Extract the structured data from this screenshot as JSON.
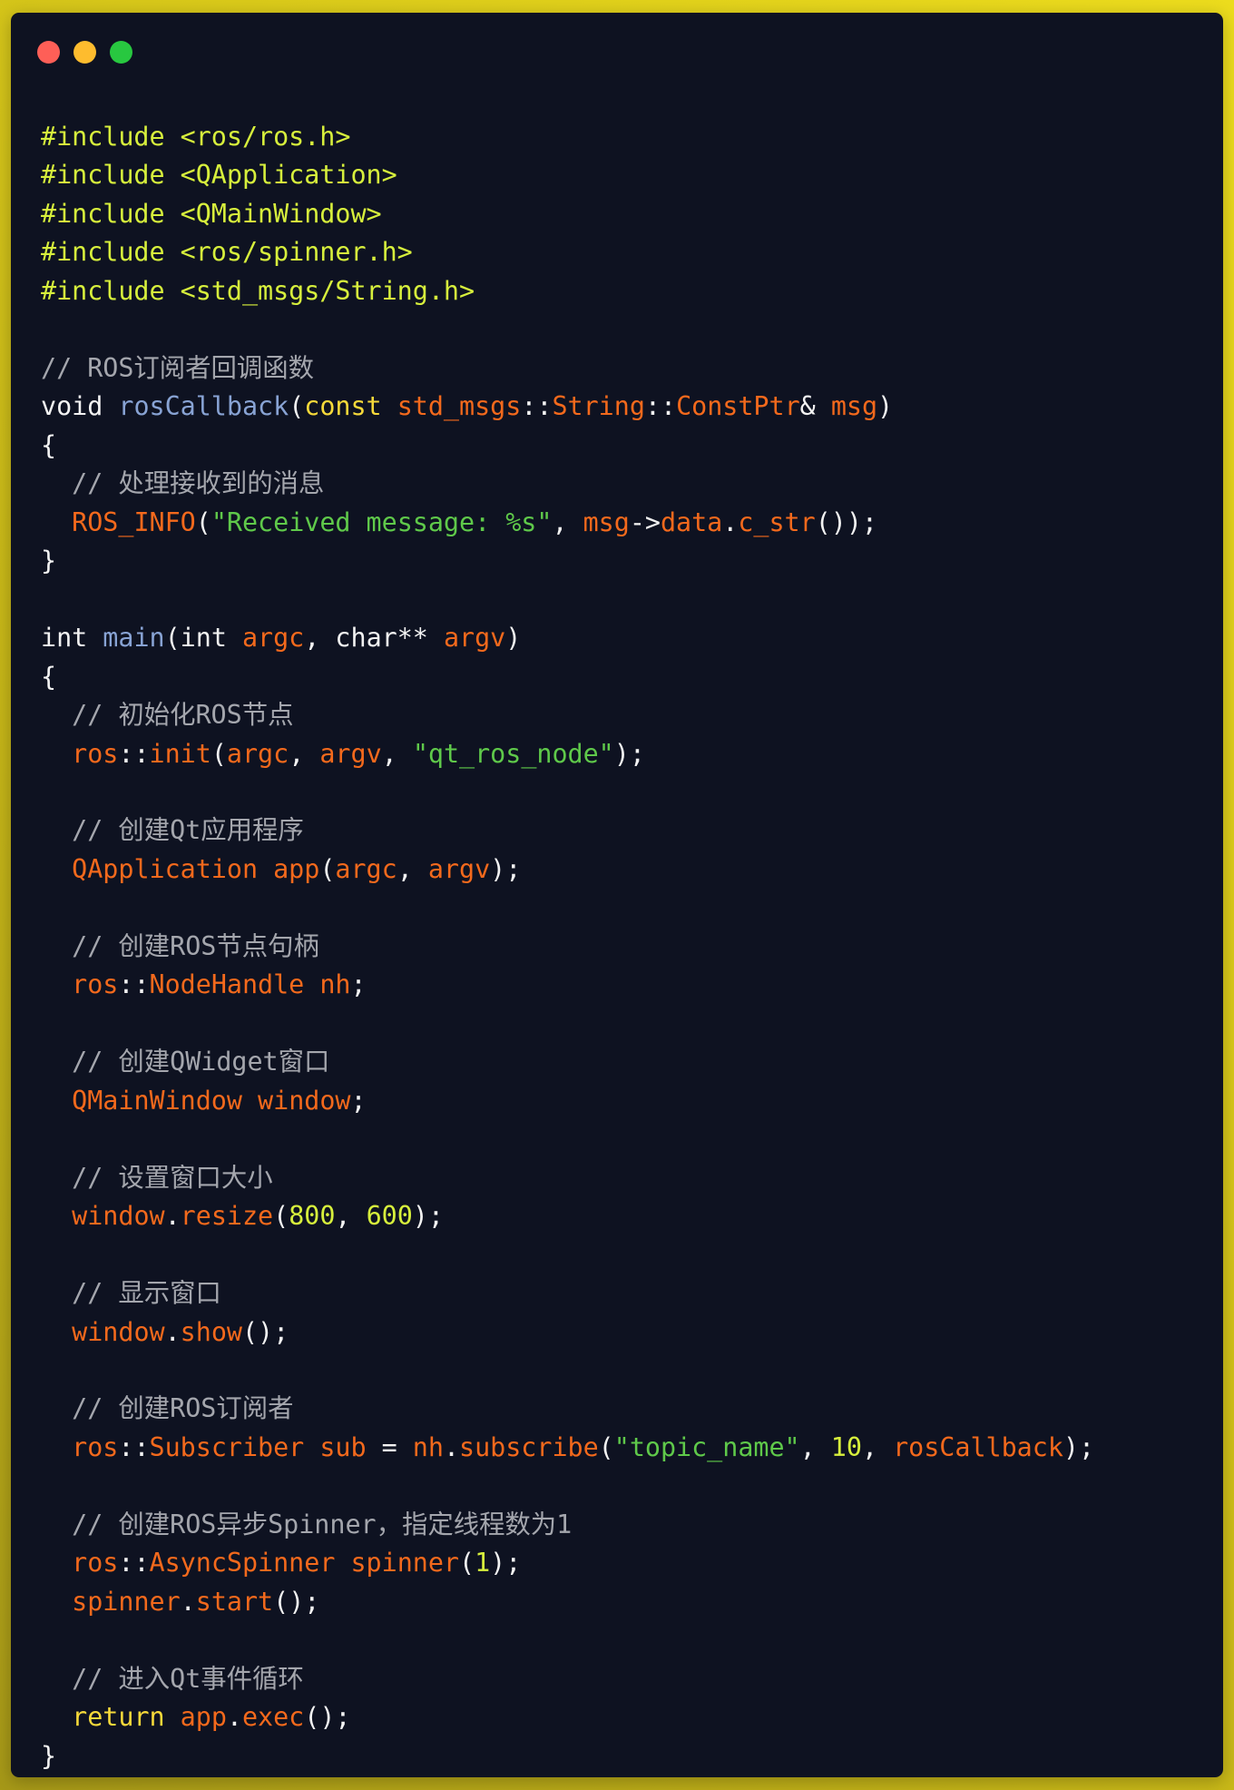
{
  "window": {
    "controls": [
      {
        "name": "close",
        "color": "#fe5f57"
      },
      {
        "name": "minimize",
        "color": "#febc2e"
      },
      {
        "name": "maximize",
        "color": "#28c840"
      }
    ]
  },
  "theme": {
    "background_gradient": [
      "#ecdc1d",
      "#a69818"
    ],
    "editor_background": "#0e1221",
    "token_colors": {
      "pre": "#d7ef3c",
      "kw": "#f6d93a",
      "plain": "#f2f2f2",
      "func": "#88a3d4",
      "var": "#f3691c",
      "str": "#5fc94a",
      "num": "#d7ef3c",
      "comment": "#a4a6ad"
    }
  },
  "code": {
    "language": "cpp",
    "lines": [
      [
        [
          "#include <ros/ros.h>",
          "pre"
        ]
      ],
      [
        [
          "#include <QApplication>",
          "pre"
        ]
      ],
      [
        [
          "#include <QMainWindow>",
          "pre"
        ]
      ],
      [
        [
          "#include <ros/spinner.h>",
          "pre"
        ]
      ],
      [
        [
          "#include <std_msgs/String.h>",
          "pre"
        ]
      ],
      [],
      [
        [
          "// ROS订阅者回调函数",
          "comment"
        ]
      ],
      [
        [
          "void ",
          "plain"
        ],
        [
          "rosCallback",
          "func"
        ],
        [
          "(",
          "plain"
        ],
        [
          "const",
          "kw"
        ],
        [
          " ",
          "plain"
        ],
        [
          "std_msgs",
          "var"
        ],
        [
          "::",
          "plain"
        ],
        [
          "String",
          "var"
        ],
        [
          "::",
          "plain"
        ],
        [
          "ConstPtr",
          "var"
        ],
        [
          "&",
          "plain"
        ],
        [
          " ",
          "plain"
        ],
        [
          "msg",
          "var"
        ],
        [
          ")",
          "plain"
        ]
      ],
      [
        [
          "{",
          "plain"
        ]
      ],
      [
        [
          "  ",
          "plain"
        ],
        [
          "// 处理接收到的消息",
          "comment"
        ]
      ],
      [
        [
          "  ",
          "plain"
        ],
        [
          "ROS_INFO",
          "var"
        ],
        [
          "(",
          "plain"
        ],
        [
          "\"Received message: %s\"",
          "str"
        ],
        [
          ", ",
          "plain"
        ],
        [
          "msg",
          "var"
        ],
        [
          "->",
          "plain"
        ],
        [
          "data",
          "var"
        ],
        [
          ".",
          "plain"
        ],
        [
          "c_str",
          "var"
        ],
        [
          "());",
          "plain"
        ]
      ],
      [
        [
          "}",
          "plain"
        ]
      ],
      [],
      [
        [
          "int ",
          "plain"
        ],
        [
          "main",
          "func"
        ],
        [
          "(",
          "plain"
        ],
        [
          "int ",
          "plain"
        ],
        [
          "argc",
          "var"
        ],
        [
          ", ",
          "plain"
        ],
        [
          "char** ",
          "plain"
        ],
        [
          "argv",
          "var"
        ],
        [
          ")",
          "plain"
        ]
      ],
      [
        [
          "{",
          "plain"
        ]
      ],
      [
        [
          "  ",
          "plain"
        ],
        [
          "// 初始化ROS节点",
          "comment"
        ]
      ],
      [
        [
          "  ",
          "plain"
        ],
        [
          "ros",
          "var"
        ],
        [
          "::",
          "plain"
        ],
        [
          "init",
          "var"
        ],
        [
          "(",
          "plain"
        ],
        [
          "argc",
          "var"
        ],
        [
          ", ",
          "plain"
        ],
        [
          "argv",
          "var"
        ],
        [
          ", ",
          "plain"
        ],
        [
          "\"qt_ros_node\"",
          "str"
        ],
        [
          ");",
          "plain"
        ]
      ],
      [],
      [
        [
          "  ",
          "plain"
        ],
        [
          "// 创建Qt应用程序",
          "comment"
        ]
      ],
      [
        [
          "  ",
          "plain"
        ],
        [
          "QApplication",
          "var"
        ],
        [
          " ",
          "plain"
        ],
        [
          "app",
          "var"
        ],
        [
          "(",
          "plain"
        ],
        [
          "argc",
          "var"
        ],
        [
          ", ",
          "plain"
        ],
        [
          "argv",
          "var"
        ],
        [
          ");",
          "plain"
        ]
      ],
      [],
      [
        [
          "  ",
          "plain"
        ],
        [
          "// 创建ROS节点句柄",
          "comment"
        ]
      ],
      [
        [
          "  ",
          "plain"
        ],
        [
          "ros",
          "var"
        ],
        [
          "::",
          "plain"
        ],
        [
          "NodeHandle",
          "var"
        ],
        [
          " ",
          "plain"
        ],
        [
          "nh",
          "var"
        ],
        [
          ";",
          "plain"
        ]
      ],
      [],
      [
        [
          "  ",
          "plain"
        ],
        [
          "// 创建QWidget窗口",
          "comment"
        ]
      ],
      [
        [
          "  ",
          "plain"
        ],
        [
          "QMainWindow",
          "var"
        ],
        [
          " ",
          "plain"
        ],
        [
          "window",
          "var"
        ],
        [
          ";",
          "plain"
        ]
      ],
      [],
      [
        [
          "  ",
          "plain"
        ],
        [
          "// 设置窗口大小",
          "comment"
        ]
      ],
      [
        [
          "  ",
          "plain"
        ],
        [
          "window",
          "var"
        ],
        [
          ".",
          "plain"
        ],
        [
          "resize",
          "var"
        ],
        [
          "(",
          "plain"
        ],
        [
          "800",
          "num"
        ],
        [
          ", ",
          "plain"
        ],
        [
          "600",
          "num"
        ],
        [
          ");",
          "plain"
        ]
      ],
      [],
      [
        [
          "  ",
          "plain"
        ],
        [
          "// 显示窗口",
          "comment"
        ]
      ],
      [
        [
          "  ",
          "plain"
        ],
        [
          "window",
          "var"
        ],
        [
          ".",
          "plain"
        ],
        [
          "show",
          "var"
        ],
        [
          "();",
          "plain"
        ]
      ],
      [],
      [
        [
          "  ",
          "plain"
        ],
        [
          "// 创建ROS订阅者",
          "comment"
        ]
      ],
      [
        [
          "  ",
          "plain"
        ],
        [
          "ros",
          "var"
        ],
        [
          "::",
          "plain"
        ],
        [
          "Subscriber",
          "var"
        ],
        [
          " ",
          "plain"
        ],
        [
          "sub",
          "var"
        ],
        [
          " = ",
          "plain"
        ],
        [
          "nh",
          "var"
        ],
        [
          ".",
          "plain"
        ],
        [
          "subscribe",
          "var"
        ],
        [
          "(",
          "plain"
        ],
        [
          "\"topic_name\"",
          "str"
        ],
        [
          ", ",
          "plain"
        ],
        [
          "10",
          "num"
        ],
        [
          ", ",
          "plain"
        ],
        [
          "rosCallback",
          "var"
        ],
        [
          ");",
          "plain"
        ]
      ],
      [],
      [
        [
          "  ",
          "plain"
        ],
        [
          "// 创建ROS异步Spinner，指定线程数为1",
          "comment"
        ]
      ],
      [
        [
          "  ",
          "plain"
        ],
        [
          "ros",
          "var"
        ],
        [
          "::",
          "plain"
        ],
        [
          "AsyncSpinner",
          "var"
        ],
        [
          " ",
          "plain"
        ],
        [
          "spinner",
          "var"
        ],
        [
          "(",
          "plain"
        ],
        [
          "1",
          "num"
        ],
        [
          ");",
          "plain"
        ]
      ],
      [
        [
          "  ",
          "plain"
        ],
        [
          "spinner",
          "var"
        ],
        [
          ".",
          "plain"
        ],
        [
          "start",
          "var"
        ],
        [
          "();",
          "plain"
        ]
      ],
      [],
      [
        [
          "  ",
          "plain"
        ],
        [
          "// 进入Qt事件循环",
          "comment"
        ]
      ],
      [
        [
          "  ",
          "plain"
        ],
        [
          "return",
          "kw"
        ],
        [
          " ",
          "plain"
        ],
        [
          "app",
          "var"
        ],
        [
          ".",
          "plain"
        ],
        [
          "exec",
          "var"
        ],
        [
          "();",
          "plain"
        ]
      ],
      [
        [
          "}",
          "plain"
        ]
      ]
    ]
  }
}
